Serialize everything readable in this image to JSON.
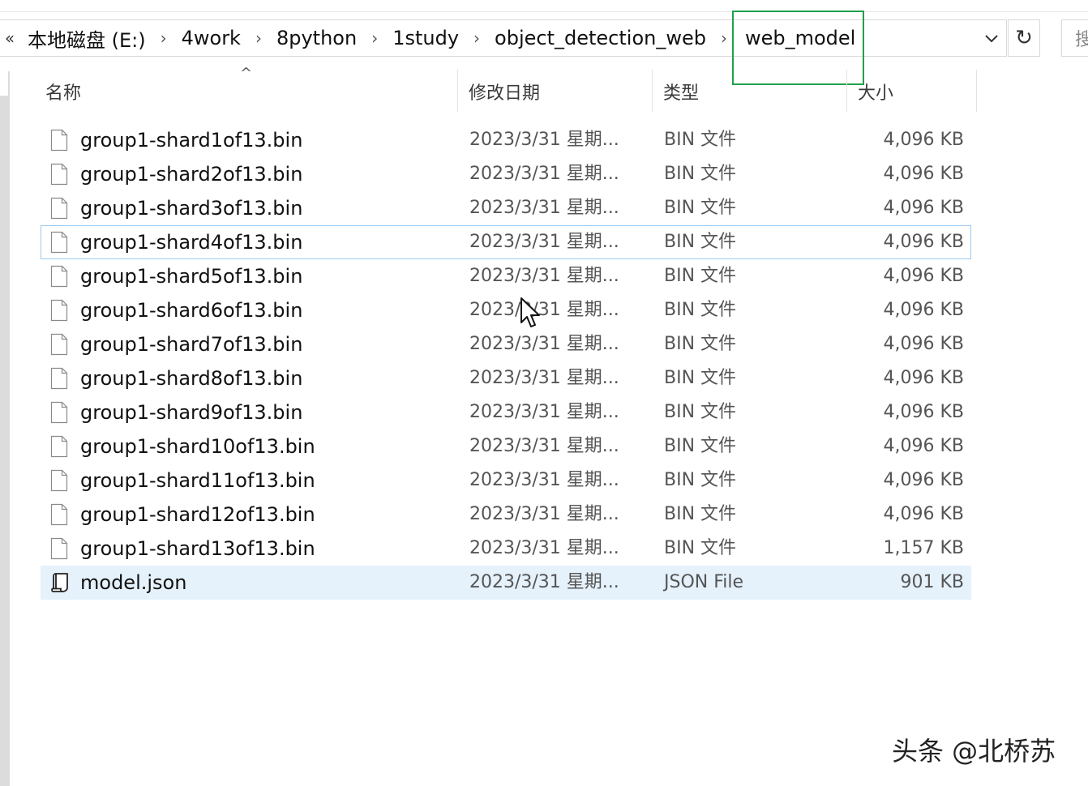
{
  "address": {
    "overflow_glyph": "«",
    "crumbs": [
      "本地磁盘 (E:)",
      "4work",
      "8python",
      "1study",
      "object_detection_web"
    ],
    "separator": "›",
    "current": "web_model",
    "dropdown_glyph": "⌄",
    "refresh_glyph": "↻",
    "search_glyph": "搜"
  },
  "columns": {
    "name": "名称",
    "date": "修改日期",
    "type": "类型",
    "size": "大小",
    "sort_glyph": "^"
  },
  "files": [
    {
      "name": "group1-shard1of13.bin",
      "date": "2023/3/31 星期...",
      "type": "BIN 文件",
      "size": "4,096 KB",
      "icon": "file-icon"
    },
    {
      "name": "group1-shard2of13.bin",
      "date": "2023/3/31 星期...",
      "type": "BIN 文件",
      "size": "4,096 KB",
      "icon": "file-icon"
    },
    {
      "name": "group1-shard3of13.bin",
      "date": "2023/3/31 星期...",
      "type": "BIN 文件",
      "size": "4,096 KB",
      "icon": "file-icon"
    },
    {
      "name": "group1-shard4of13.bin",
      "date": "2023/3/31 星期...",
      "type": "BIN 文件",
      "size": "4,096 KB",
      "icon": "file-icon"
    },
    {
      "name": "group1-shard5of13.bin",
      "date": "2023/3/31 星期...",
      "type": "BIN 文件",
      "size": "4,096 KB",
      "icon": "file-icon"
    },
    {
      "name": "group1-shard6of13.bin",
      "date": "2023/3/31 星期...",
      "type": "BIN 文件",
      "size": "4,096 KB",
      "icon": "file-icon"
    },
    {
      "name": "group1-shard7of13.bin",
      "date": "2023/3/31 星期...",
      "type": "BIN 文件",
      "size": "4,096 KB",
      "icon": "file-icon"
    },
    {
      "name": "group1-shard8of13.bin",
      "date": "2023/3/31 星期...",
      "type": "BIN 文件",
      "size": "4,096 KB",
      "icon": "file-icon"
    },
    {
      "name": "group1-shard9of13.bin",
      "date": "2023/3/31 星期...",
      "type": "BIN 文件",
      "size": "4,096 KB",
      "icon": "file-icon"
    },
    {
      "name": "group1-shard10of13.bin",
      "date": "2023/3/31 星期...",
      "type": "BIN 文件",
      "size": "4,096 KB",
      "icon": "file-icon"
    },
    {
      "name": "group1-shard11of13.bin",
      "date": "2023/3/31 星期...",
      "type": "BIN 文件",
      "size": "4,096 KB",
      "icon": "file-icon"
    },
    {
      "name": "group1-shard12of13.bin",
      "date": "2023/3/31 星期...",
      "type": "BIN 文件",
      "size": "4,096 KB",
      "icon": "file-icon"
    },
    {
      "name": "group1-shard13of13.bin",
      "date": "2023/3/31 星期...",
      "type": "BIN 文件",
      "size": "1,157 KB",
      "icon": "file-icon"
    },
    {
      "name": "model.json",
      "date": "2023/3/31 星期...",
      "type": "JSON File",
      "size": "901 KB",
      "icon": "json-script-icon"
    }
  ],
  "focused_row": 3,
  "selected_row": 13,
  "watermark": "头条 @北桥苏",
  "colors": {
    "highlight_box": "#1fa04a",
    "selection": "#e5f1fb",
    "focus_border": "#99c9ef"
  }
}
